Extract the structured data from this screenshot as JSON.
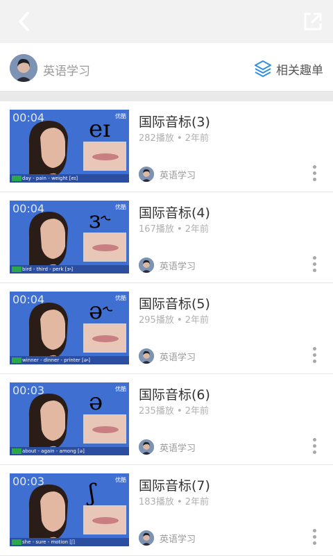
{
  "header": {
    "back_icon": "chevron-left-icon",
    "share_icon": "share-external-icon"
  },
  "channel": {
    "name": "英语学习",
    "related_label": "相关趣单",
    "related_icon": "layers-icon",
    "accent": "#2f8fe0"
  },
  "videos": [
    {
      "duration": "00:04",
      "symbol": "eɪ",
      "caption": "day - pain - weight [eɪ]",
      "title": "国际音标(3)",
      "meta": "282播放 • 2年前",
      "uploader": "英语学习"
    },
    {
      "duration": "00:04",
      "symbol": "ɜ˞",
      "caption": "bird - third - perk [ɜ˞]",
      "title": "国际音标(4)",
      "meta": "167播放 • 2年前",
      "uploader": "英语学习"
    },
    {
      "duration": "00:04",
      "symbol": "ə˞",
      "caption": "winner - dinner - printer [ə˞]",
      "title": "国际音标(5)",
      "meta": "295播放 • 2年前",
      "uploader": "英语学习"
    },
    {
      "duration": "00:03",
      "symbol": "ə",
      "caption": "about - again - among [ə]",
      "title": "国际音标(6)",
      "meta": "235播放 • 2年前",
      "uploader": "英语学习"
    },
    {
      "duration": "00:03",
      "symbol": "ʃ",
      "caption": "she - sure - motion [ʃ]",
      "title": "国际音标(7)",
      "meta": "183播放 • 2年前",
      "uploader": "英语学习"
    }
  ]
}
